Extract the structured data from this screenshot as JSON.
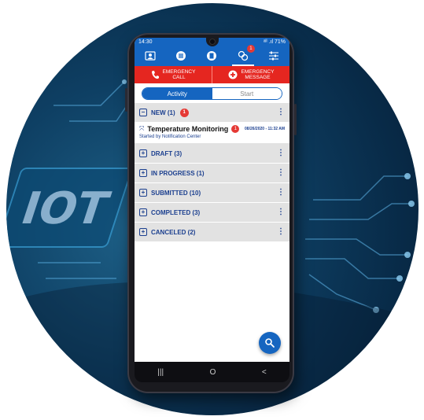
{
  "status_bar": {
    "time": "14:30",
    "signal": "ᵃˡˡ .ıl",
    "battery": "71%"
  },
  "nav": {
    "items": [
      {
        "icon": "contact-card-icon"
      },
      {
        "icon": "list-icon"
      },
      {
        "icon": "form-icon"
      },
      {
        "icon": "activity-icon",
        "badge": "1"
      },
      {
        "icon": "filter-sliders-icon"
      }
    ]
  },
  "emergency": {
    "call_line1": "EMERGENCY",
    "call_line2": "CALL",
    "message_line1": "EMERGENCY",
    "message_line2": "MESSAGE"
  },
  "tabs": {
    "activity": "Activity",
    "start": "Start"
  },
  "sections": [
    {
      "label": "NEW (1)",
      "badge": "1",
      "expanded": true
    },
    {
      "label": "DRAFT (3)",
      "expanded": false
    },
    {
      "label": "IN PROGRESS (1)",
      "expanded": false
    },
    {
      "label": "SUBMITTED (10)",
      "expanded": false
    },
    {
      "label": "COMPLETED (3)",
      "expanded": false
    },
    {
      "label": "CANCELED (2)",
      "expanded": false
    }
  ],
  "activity": {
    "title": "Temperature Monitoring",
    "badge": "1",
    "date": "08/26/2020 - 11:32 AM",
    "subtitle": "Started by Notification Center"
  },
  "android_nav": {
    "recent": "|||",
    "home": "O",
    "back": "<"
  },
  "colors": {
    "primary": "#1565c0",
    "emergency": "#e52620",
    "section_bg": "#e2e2e2",
    "badge": "#e53935"
  },
  "background": {
    "watermark": "IOT"
  }
}
